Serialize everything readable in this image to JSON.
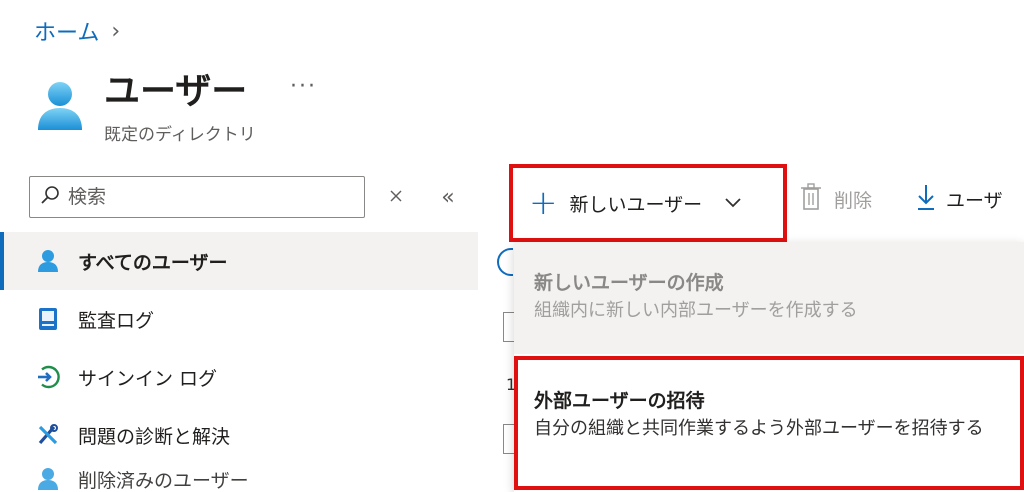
{
  "breadcrumb": {
    "home": "ホーム",
    "separator": "›"
  },
  "header": {
    "title": "ユーザー",
    "subtitle": "既定のディレクトリ",
    "more": "···"
  },
  "search": {
    "placeholder": "検索"
  },
  "sidebar": {
    "collapse": "«",
    "items": [
      {
        "label": "すべてのユーザー",
        "icon": "user-icon"
      },
      {
        "label": "監査ログ",
        "icon": "audit-log-icon"
      },
      {
        "label": "サインイン ログ",
        "icon": "sign-in-icon"
      },
      {
        "label": "問題の診断と解決",
        "icon": "wrench-icon"
      },
      {
        "label": "削除済みのユーザー",
        "icon": "user-icon"
      }
    ]
  },
  "toolbar": {
    "new_user": "新しいユーザー",
    "delete": "削除",
    "download": "ユーザ"
  },
  "dropdown": {
    "items": [
      {
        "title": "新しいユーザーの作成",
        "desc": "組織内に新しい内部ユーザーを作成する"
      },
      {
        "title": "外部ユーザーの招待",
        "desc": "自分の組織と共同作業するよう外部ユーザーを招待する"
      }
    ]
  },
  "behind": {
    "row_number": "1"
  },
  "colors": {
    "accent": "#0f6cbd",
    "highlight": "#e01010",
    "nav_active_bg": "#f3f2f1"
  }
}
